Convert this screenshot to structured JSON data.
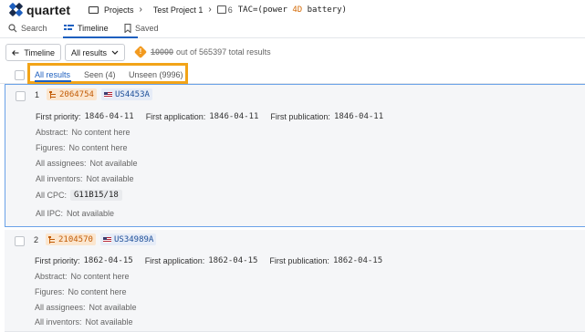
{
  "app": {
    "name": "quartet",
    "brand_colors": {
      "blue": "#1d5fbf",
      "orange": "#f29a1f",
      "navy": "#1a2b4a"
    }
  },
  "breadcrumb": {
    "projects": "Projects",
    "project": "Test Project 1",
    "query_num": "6",
    "query_prefix": "TAC=(power ",
    "query_kw": "4D",
    "query_suffix": " battery)"
  },
  "tabs": [
    {
      "label": "Search",
      "icon": "search-icon",
      "active": false
    },
    {
      "label": "Timeline",
      "icon": "timeline-icon",
      "active": true
    },
    {
      "label": "Saved",
      "icon": "bookmark-icon",
      "active": false
    }
  ],
  "toolbar": {
    "back_label": "Timeline",
    "dropdown_value": "All results",
    "result_count": "10000",
    "result_text": "out of 565397 total results"
  },
  "filters": [
    {
      "label": "All results",
      "active": true
    },
    {
      "label": "Seen (4)",
      "active": false
    },
    {
      "label": "Unseen (9996)",
      "active": false
    }
  ],
  "labels": {
    "first_priority": "First priority:",
    "first_application": "First application:",
    "first_publication": "First publication:",
    "abstract": "Abstract:",
    "figures": "Figures:",
    "assignees": "All assignees:",
    "inventors": "All inventors:",
    "cpc": "All CPC:",
    "ipc": "All IPC:",
    "no_content": "No content here",
    "not_available": "Not available"
  },
  "results": [
    {
      "index": "1",
      "family": "2064754",
      "publication": "US4453A",
      "first_priority": "1846-04-11",
      "first_application": "1846-04-11",
      "first_publication": "1846-04-11",
      "cpc": "G11B15/18"
    },
    {
      "index": "2",
      "family": "2104570",
      "publication": "US34989A",
      "first_priority": "1862-04-15",
      "first_application": "1862-04-15",
      "first_publication": "1862-04-15"
    }
  ]
}
